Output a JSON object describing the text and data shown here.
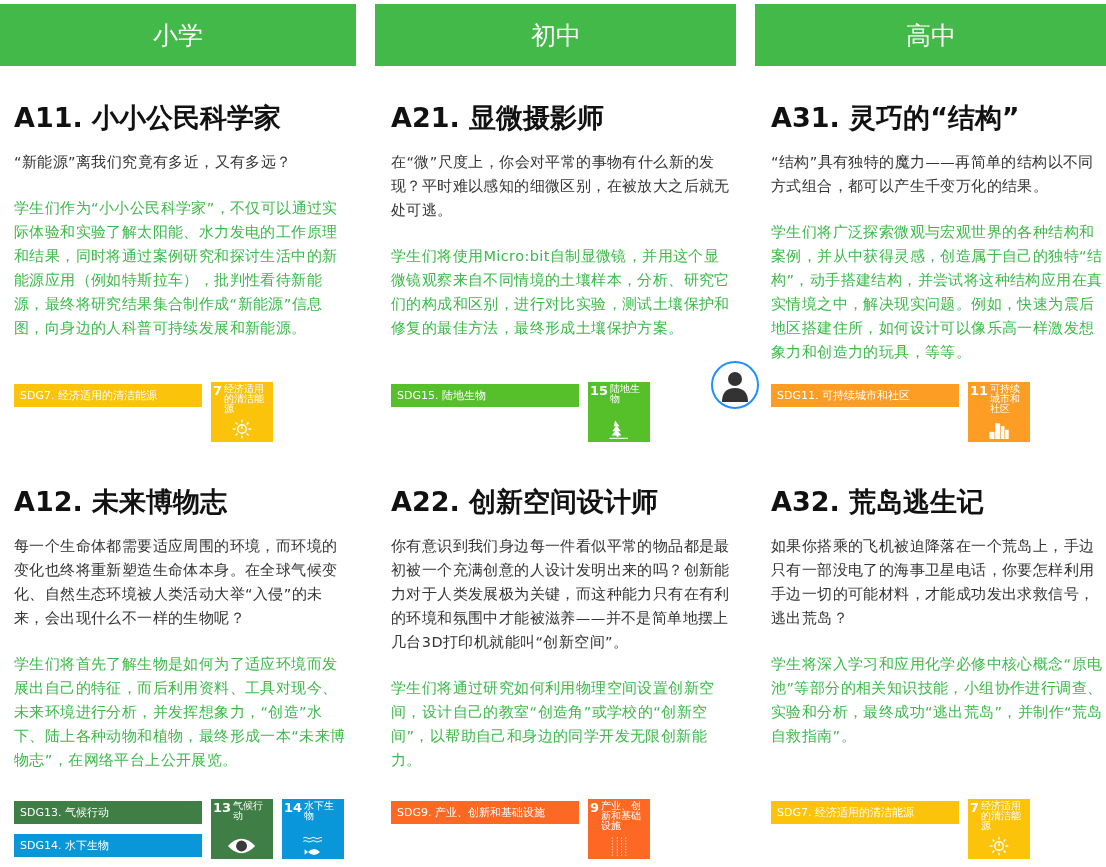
{
  "columns": [
    {
      "header": "小学",
      "projects": [
        {
          "title": "A11. 小小公民科学家",
          "question": "“新能源”离我们究竟有多近，又有多远？",
          "description": "学生们作为“小小公民科学家”，不仅可以通过实际体验和实验了解太阳能、水力发电的工作原理和结果，同时将通过案例研究和探讨生活中的新能源应用（例如特斯拉车），批判性看待新能源，最终将研究结果集合制作成“新能源”信息图，向身边的人科普可持续发展和新能源。",
          "sdgs": [
            {
              "label": "SDG7. 经济适用的清洁能源",
              "number": "7",
              "tile_label": "经济适用的清洁能源",
              "color": "#fcc30b",
              "kind": "sun"
            }
          ]
        },
        {
          "title": "A12. 未来博物志",
          "question": "每一个生命体都需要适应周围的环境，而环境的变化也终将重新塑造生命体本身。在全球气候变化、自然生态环境被人类活动大举“入侵”的未来，会出现什么不一样的生物呢？",
          "description": "学生们将首先了解生物是如何为了适应环境而发展出自己的特征，而后利用资料、工具对现今、未来环境进行分析，并发挥想象力，“创造”水下、陆上各种动物和植物，最终形成一本“未来博物志”，在网络平台上公开展览。",
          "sdgs": [
            {
              "label": "SDG13. 气候行动",
              "number": "13",
              "tile_label": "气候行动",
              "color": "#3f7e44",
              "kind": "eye"
            },
            {
              "label": "SDG14. 水下生物",
              "number": "14",
              "tile_label": "水下生物",
              "color": "#0a97d9",
              "kind": "fish"
            }
          ]
        }
      ]
    },
    {
      "header": "初中",
      "projects": [
        {
          "title": "A21. 显微摄影师",
          "question": "在“微”尺度上，你会对平常的事物有什么新的发现？平时难以感知的细微区别，在被放大之后就无处可逃。",
          "description": "学生们将使用Micro:bit自制显微镜，并用这个显微镜观察来自不同情境的土壤样本，分析、研究它们的构成和区别，进行对比实验，测试土壤保护和修复的最佳方法，最终形成土壤保护方案。",
          "sdgs": [
            {
              "label": "SDG15. 陆地生物",
              "number": "15",
              "tile_label": "陆地生物",
              "color": "#56c02b",
              "kind": "tree"
            }
          ]
        },
        {
          "title": "A22. 创新空间设计师",
          "question": "你有意识到我们身边每一件看似平常的物品都是最初被一个充满创意的人设计发明出来的吗？创新能力对于人类发展极为关键，而这种能力只有在有利的环境和氛围中才能被滋养——并不是简单地摆上几台3D打印机就能叫“创新空间”。",
          "description": "学生们将通过研究如何利用物理空间设置创新空间，设计自己的教室“创造角”或学校的“创新空间”，以帮助自己和身边的同学开发无限创新能力。",
          "sdgs": [
            {
              "label": "SDG9. 产业、创新和基础设施",
              "number": "9",
              "tile_label": "产业、创新和基础设施",
              "color": "#fd6925",
              "kind": "bars"
            }
          ]
        }
      ]
    },
    {
      "header": "高中",
      "projects": [
        {
          "title": "A31. 灵巧的“结构”",
          "question": "“结构”具有独特的魔力——再简单的结构以不同方式组合，都可以产生千变万化的结果。",
          "description": "学生们将广泛探索微观与宏观世界的各种结构和案例，并从中获得灵感，创造属于自己的独特“结构”，动手搭建结构，并尝试将这种结构应用在真实情境之中，解决现实问题。例如，快速为震后地区搭建住所，如何设计可以像乐高一样激发想象力和创造力的玩具，等等。",
          "sdgs": [
            {
              "label": "SDG11. 可持续城市和社区",
              "number": "11",
              "tile_label": "可持续城市和社区",
              "color": "#fd9d24",
              "kind": "buildings"
            }
          ]
        },
        {
          "title": "A32. 荒岛逃生记",
          "question": "如果你搭乘的飞机被迫降落在一个荒岛上，手边只有一部没电了的海事卫星电话，你要怎样利用手边一切的可能材料，才能成功发出求救信号，逃出荒岛？",
          "description": "学生将深入学习和应用化学必修中核心概念“原电池”等部分的相关知识技能，小组协作进行调查、实验和分析，最终成功“逃出荒岛”，并制作“荒岛自救指南”。",
          "sdgs": [
            {
              "label": "SDG7. 经济适用的清洁能源",
              "number": "7",
              "tile_label": "经济适用的清洁能源",
              "color": "#fcc30b",
              "kind": "sun"
            }
          ]
        }
      ]
    }
  ]
}
